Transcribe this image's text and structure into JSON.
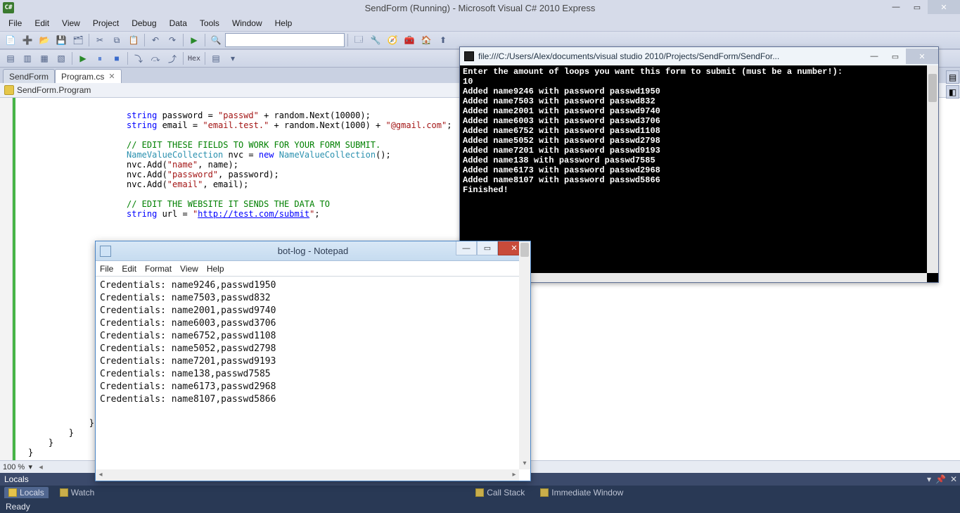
{
  "vs": {
    "title": "SendForm (Running) - Microsoft Visual C# 2010 Express",
    "menu": [
      "File",
      "Edit",
      "View",
      "Project",
      "Debug",
      "Data",
      "Tools",
      "Window",
      "Help"
    ],
    "tabs": [
      {
        "label": "SendForm",
        "active": false
      },
      {
        "label": "Program.cs",
        "active": true
      }
    ],
    "crumb": "SendForm.Program",
    "zoom": "100 %",
    "hex_label": "Hex",
    "panels": {
      "locals_header": "Locals",
      "tab_locals": "Locals",
      "tab_watch": "Watch",
      "tab_callstack": "Call Stack",
      "tab_immediate": "Immediate Window"
    },
    "status": "Ready",
    "code": {
      "l1a": "string",
      "l1b": " password = ",
      "l1c": "\"passwd\"",
      "l1d": " + random.Next(10000);",
      "l2a": "string",
      "l2b": " email = ",
      "l2c": "\"email.test.\"",
      "l2d": " + random.Next(1000) + ",
      "l2e": "\"@gmail.com\"",
      "l2f": ";",
      "c1": "// EDIT THESE FIELDS TO WORK FOR YOUR FORM SUBMIT.",
      "l3a": "NameValueCollection",
      "l3b": " nvc = ",
      "l3c": "new",
      "l3d": " ",
      "l3e": "NameValueCollection",
      "l3f": "();",
      "l4a": "nvc.Add(",
      "l4b": "\"name\"",
      "l4c": ", name);",
      "l5a": "nvc.Add(",
      "l5b": "\"password\"",
      "l5c": ", password);",
      "l6a": "nvc.Add(",
      "l6b": "\"email\"",
      "l6c": ", email);",
      "c2": "// EDIT THE WEBSITE IT SENDS THE DATA TO",
      "l7a": "string",
      "l7b": " url = ",
      "l7c": "\"",
      "l7d": "http://test.com/submit",
      "l7e": "\"",
      "l7f": ";",
      "braces": "            }\n        }\n    }\n}"
    }
  },
  "console": {
    "title": "file:///C:/Users/Alex/documents/visual studio 2010/Projects/SendForm/SendFor...",
    "lines": "Enter the amount of loops you want this form to submit (must be a number!):\n10\nAdded name9246 with password passwd1950\nAdded name7503 with password passwd832\nAdded name2001 with password passwd9740\nAdded name6003 with password passwd3706\nAdded name6752 with password passwd1108\nAdded name5052 with password passwd2798\nAdded name7201 with password passwd9193\nAdded name138 with password passwd7585\nAdded name6173 with password passwd2968\nAdded name8107 with password passwd5866\nFinished!"
  },
  "notepad": {
    "title": "bot-log - Notepad",
    "menu": [
      "File",
      "Edit",
      "Format",
      "View",
      "Help"
    ],
    "lines": "Credentials: name9246,passwd1950\nCredentials: name7503,passwd832\nCredentials: name2001,passwd9740\nCredentials: name6003,passwd3706\nCredentials: name6752,passwd1108\nCredentials: name5052,passwd2798\nCredentials: name7201,passwd9193\nCredentials: name138,passwd7585\nCredentials: name6173,passwd2968\nCredentials: name8107,passwd5866"
  }
}
